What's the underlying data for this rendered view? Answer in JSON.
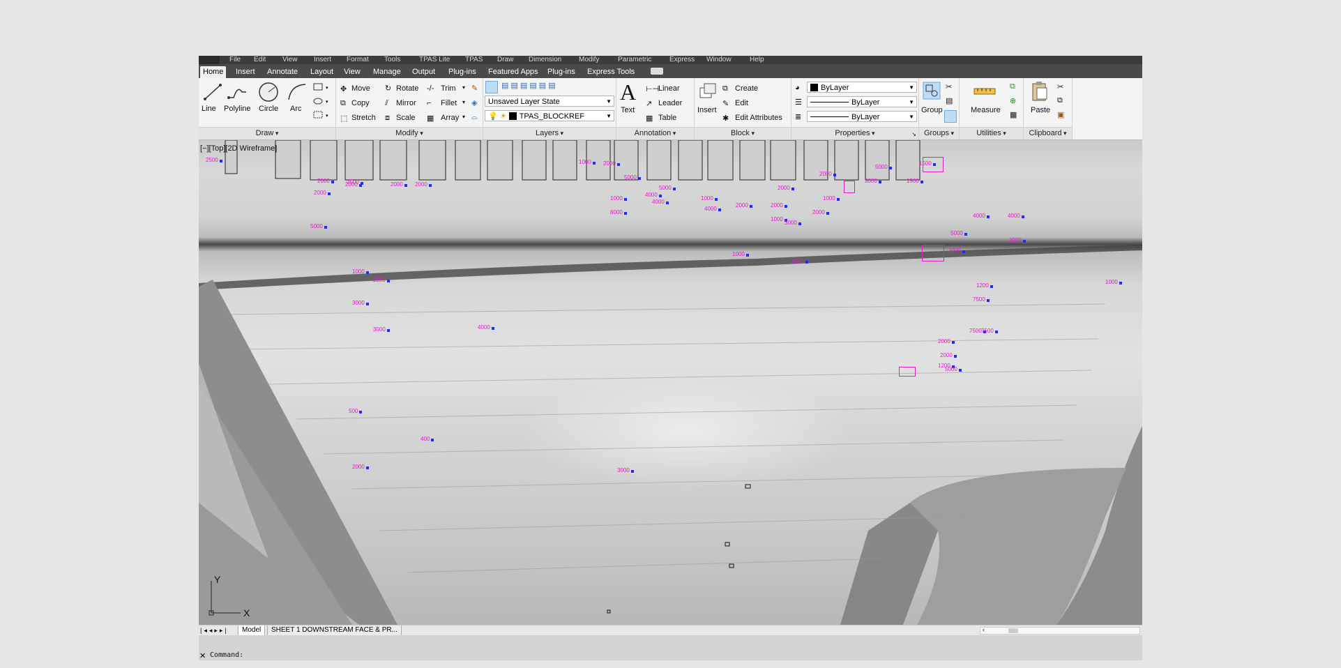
{
  "menu": [
    "File",
    "Edit",
    "View",
    "Insert",
    "Format",
    "Tools",
    "TPAS Lite",
    "TPAS",
    "Draw",
    "Dimension",
    "Modify",
    "Parametric",
    "Express",
    "Window",
    "Help"
  ],
  "ribbon_tabs": [
    "Home",
    "Insert",
    "Annotate",
    "Layout",
    "View",
    "Manage",
    "Output",
    "Plug-ins",
    "Featured Apps",
    "Plug-ins",
    "Express Tools"
  ],
  "active_tab": "Home",
  "draw": {
    "title": "Draw",
    "line": "Line",
    "polyline": "Polyline",
    "circle": "Circle",
    "arc": "Arc"
  },
  "modify": {
    "title": "Modify",
    "move": "Move",
    "rotate": "Rotate",
    "trim": "Trim",
    "copy": "Copy",
    "mirror": "Mirror",
    "fillet": "Fillet",
    "stretch": "Stretch",
    "scale": "Scale",
    "array": "Array"
  },
  "layers": {
    "title": "Layers",
    "layer_state": "Unsaved Layer State",
    "current_layer": "TPAS_BLOCKREF"
  },
  "annotation": {
    "title": "Annotation",
    "text": "Text",
    "linear": "Linear",
    "leader": "Leader",
    "table": "Table"
  },
  "block": {
    "title": "Block",
    "insert": "Insert",
    "create": "Create",
    "edit": "Edit",
    "edit_attributes": "Edit Attributes"
  },
  "properties": {
    "title": "Properties",
    "color": "ByLayer",
    "linetype": "ByLayer",
    "lineweight": "ByLayer"
  },
  "groups": {
    "title": "Groups",
    "group": "Group"
  },
  "utilities": {
    "title": "Utilities",
    "measure": "Measure"
  },
  "clipboard": {
    "title": "Clipboard",
    "paste": "Paste"
  },
  "viewport_label": "[−][Top][2D Wireframe]",
  "ucs": {
    "y": "Y",
    "x": "X"
  },
  "layout_tabs": [
    "Model",
    "SHEET 1 DOWNSTREAM FACE & PR..."
  ],
  "command_prompt": "Command:",
  "colors": {
    "accent_markup": "#e01ec8",
    "marker_blue": "#1a2cff",
    "ribbon_bg": "#f4f4f4",
    "menubar": "#3c3c3c"
  },
  "markups": [
    "2500",
    "2000",
    "2000",
    "2000",
    "2000",
    "2000",
    "2500",
    "5000",
    "1000",
    "2000",
    "3000",
    "3000",
    "2000",
    "1000",
    "5000",
    "1000",
    "4000",
    "8000",
    "4000",
    "5000",
    "4000",
    "1000",
    "2000",
    "2000",
    "2000",
    "1000",
    "3000",
    "2000",
    "1000",
    "2000",
    "3000",
    "1500",
    "5000",
    "1500",
    "1000",
    "2500",
    "4000",
    "4000",
    "5000",
    "3000",
    "3000",
    "2000",
    "7500",
    "7500",
    "7500",
    "2000",
    "1200",
    "5000",
    "1200",
    "1000",
    "500",
    "400",
    "2000",
    "3000",
    "4000"
  ]
}
